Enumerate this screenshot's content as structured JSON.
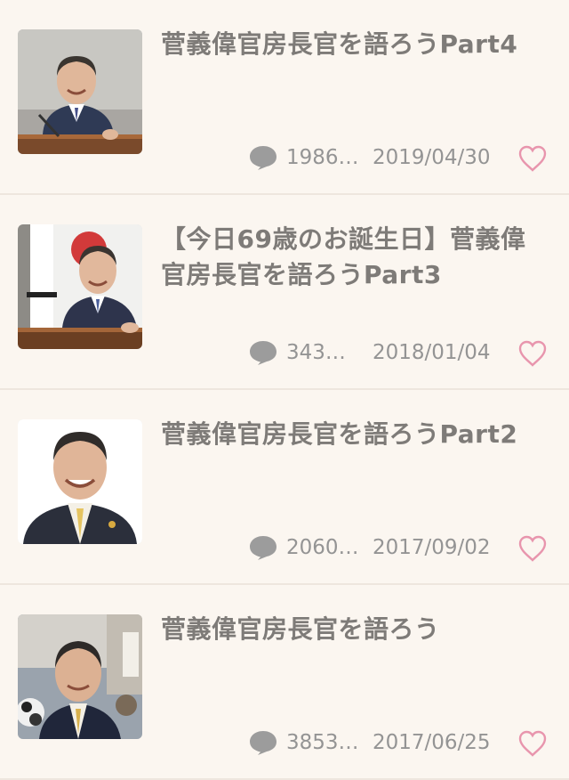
{
  "colors": {
    "background": "#fbf6f0",
    "title": "#7e7b78",
    "meta": "#949494",
    "heart": "#e895ad",
    "divider": "#eee6de"
  },
  "items": [
    {
      "title": "菅義偉官房長官を語ろうPart4",
      "comments": "1986…",
      "date": "2019/04/30",
      "comment_icon": "speech-bubble-icon",
      "like_icon": "heart-outline-icon"
    },
    {
      "title": "【今日69歳のお誕生日】菅義偉官房長官を語ろうPart3",
      "comments": "343…",
      "date": "2018/01/04",
      "comment_icon": "speech-bubble-icon",
      "like_icon": "heart-outline-icon"
    },
    {
      "title": "菅義偉官房長官を語ろうPart2",
      "comments": "2060…",
      "date": "2017/09/02",
      "comment_icon": "speech-bubble-icon",
      "like_icon": "heart-outline-icon"
    },
    {
      "title": "菅義偉官房長官を語ろう",
      "comments": "3853…",
      "date": "2017/06/25",
      "comment_icon": "speech-bubble-icon",
      "like_icon": "heart-outline-icon"
    }
  ]
}
